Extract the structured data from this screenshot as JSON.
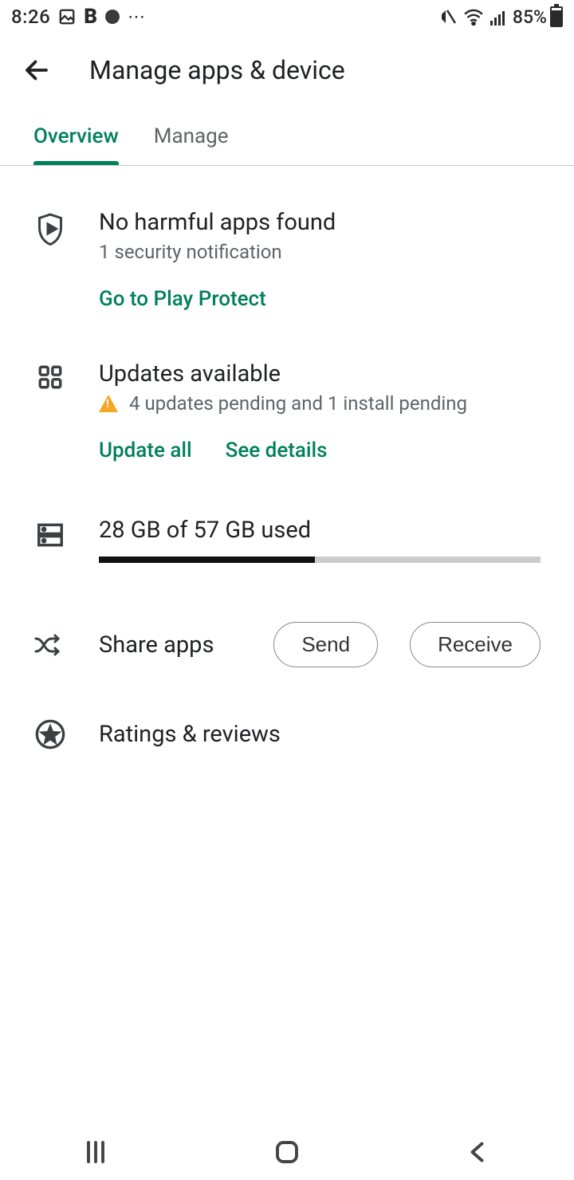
{
  "status": {
    "time": "8:26",
    "battery_pct": "85%"
  },
  "header": {
    "title": "Manage apps & device"
  },
  "tabs": {
    "overview": "Overview",
    "manage": "Manage"
  },
  "protect": {
    "title": "No harmful apps found",
    "subtitle": "1 security notification",
    "link": "Go to Play Protect"
  },
  "updates": {
    "title": "Updates available",
    "subtitle": "4 updates pending and 1 install pending",
    "update_all": "Update all",
    "see_details": "See details"
  },
  "storage": {
    "label": "28 GB of 57 GB used",
    "percent": 49
  },
  "share": {
    "label": "Share apps",
    "send": "Send",
    "receive": "Receive"
  },
  "ratings": {
    "label": "Ratings & reviews"
  }
}
